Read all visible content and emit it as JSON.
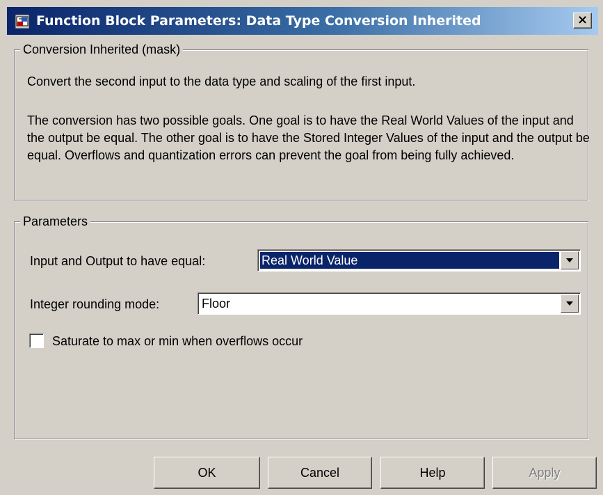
{
  "window": {
    "title": "Function Block Parameters: Data Type Conversion Inherited",
    "close_label": "×",
    "icon": "simulink-block-icon"
  },
  "mask_group": {
    "legend": "Conversion Inherited (mask)",
    "description_line1": "Convert the second input to the data type and scaling of the first input.",
    "description_line2": "The conversion has two possible goals.  One goal is to have the Real World Values of the input and the output be equal.  The other goal is to have the Stored Integer Values of the input and the output be equal.  Overflows and quantization errors can prevent the goal from being fully achieved."
  },
  "parameters_group": {
    "legend": "Parameters",
    "equal_label": "Input and Output to have equal:",
    "equal_value": "Real World Value",
    "rounding_label": "Integer rounding mode:",
    "rounding_value": "Floor",
    "saturate_label": "Saturate to max or min when overflows occur",
    "saturate_checked": false
  },
  "buttons": {
    "ok": "OK",
    "cancel": "Cancel",
    "help": "Help",
    "apply": "Apply"
  },
  "colors": {
    "titlebar_start": "#0a246a",
    "dialog_face": "#d4d0c8",
    "selection": "#0a246a"
  }
}
